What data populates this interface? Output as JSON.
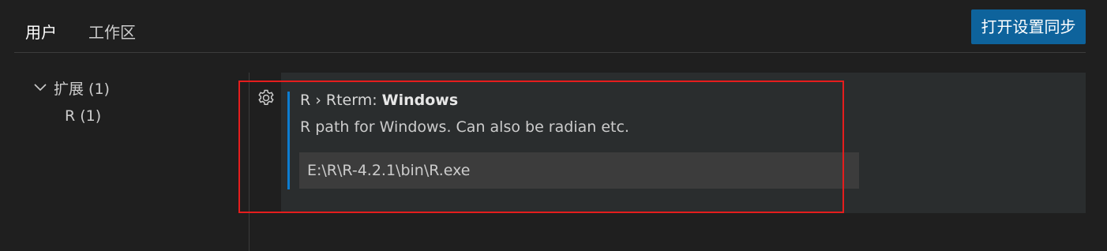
{
  "tabs": [
    {
      "label": "用户",
      "active": true
    },
    {
      "label": "工作区",
      "active": false
    }
  ],
  "sync_button": {
    "label": "打开设置同步"
  },
  "toc": {
    "group": {
      "label": "扩展 (1)"
    },
    "child": {
      "label": "R (1)"
    }
  },
  "setting": {
    "category": "R › Rterm: ",
    "name": "Windows",
    "description": "R path for Windows. Can also be radian etc.",
    "value": "E:\\R\\R-4.2.1\\bin\\R.exe"
  },
  "icons": {
    "gear": "gear-icon",
    "chevron": "chevron-down-icon"
  },
  "colors": {
    "accent_button": "#0e639c",
    "modified_indicator": "#0c7dd2",
    "highlight_box": "#e51d1d",
    "background": "#1f1f1f"
  }
}
